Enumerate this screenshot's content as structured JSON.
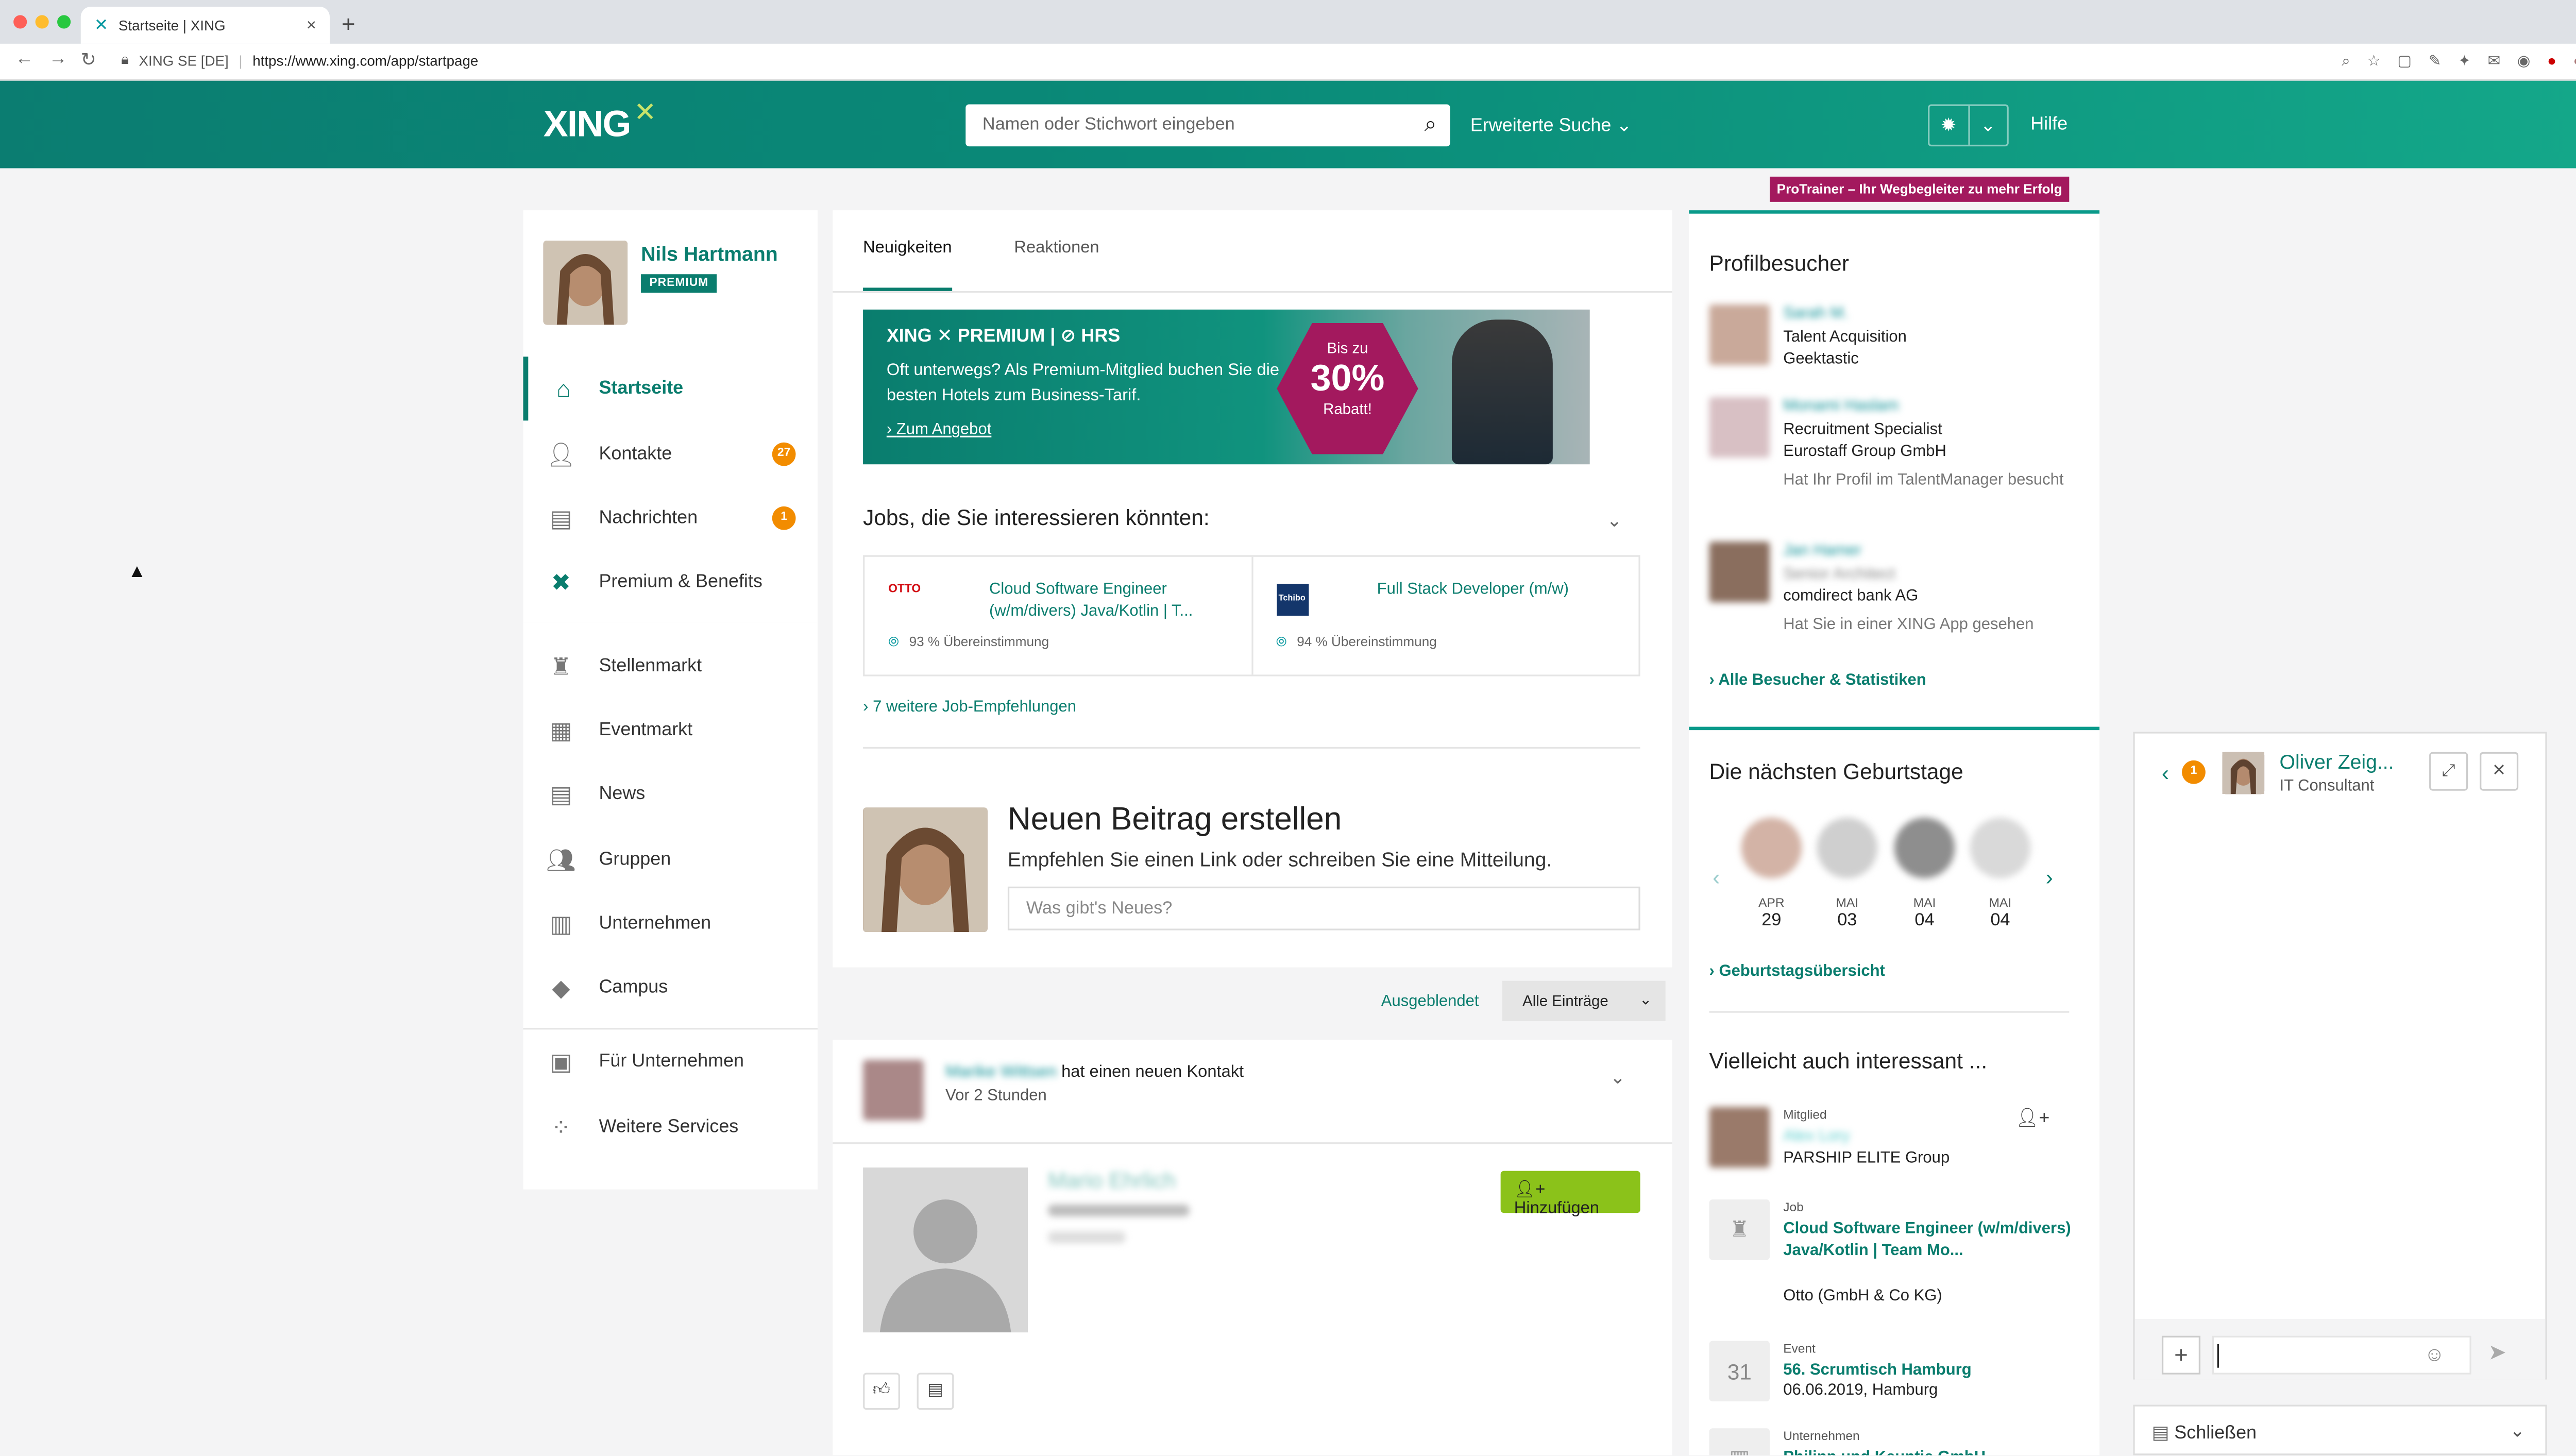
{
  "browser": {
    "tab_title": "Startseite | XING",
    "tab_close": "×",
    "new_tab": "+",
    "site_identity": "XING SE [DE]",
    "url": "https://www.xing.com/app/startpage"
  },
  "header": {
    "logo": "XING",
    "search_placeholder": "Namen oder Stichwort eingeben",
    "advanced_search": "Erweiterte Suche",
    "help": "Hilfe",
    "promo_tag": "ProTrainer – Ihr Wegbegleiter zu mehr Erfolg"
  },
  "profile": {
    "name": "Nils Hartmann",
    "badge": "PREMIUM"
  },
  "sidebar": {
    "items": [
      {
        "label": "Startseite",
        "icon": "home-icon"
      },
      {
        "label": "Kontakte",
        "icon": "person-icon",
        "badge": "27"
      },
      {
        "label": "Nachrichten",
        "icon": "chat-icon",
        "badge": "1"
      },
      {
        "label": "Premium & Benefits",
        "icon": "xing-icon"
      },
      {
        "label": "Stellenmarkt",
        "icon": "chair-icon"
      },
      {
        "label": "Eventmarkt",
        "icon": "calendar-icon"
      },
      {
        "label": "News",
        "icon": "news-icon"
      },
      {
        "label": "Gruppen",
        "icon": "group-icon"
      },
      {
        "label": "Unternehmen",
        "icon": "building-icon"
      },
      {
        "label": "Campus",
        "icon": "graduation-icon"
      },
      {
        "label": "Für Unternehmen",
        "icon": "presentation-icon"
      },
      {
        "label": "Weitere Services",
        "icon": "dots-icon"
      }
    ]
  },
  "main": {
    "tabs": [
      "Neuigkeiten",
      "Reaktionen"
    ],
    "banner": {
      "brand": "XING ✕ PREMIUM | ⊘ HRS",
      "text": "Oft unterwegs? Als Premium-Mitglied buchen Sie die besten Hotels zum Business-Tarif.",
      "link": "Zum Angebot",
      "discount_top": "Bis zu",
      "discount_value": "30%",
      "discount_bottom": "Rabatt!"
    },
    "jobs_heading": "Jobs, die Sie interessieren könnten:",
    "jobs": [
      {
        "company_logo": "OTTO",
        "title": "Cloud Software Engineer (w/m/divers) Java/Kotlin | T...",
        "match": "93 % Übereinstimmung"
      },
      {
        "company_logo": "Tchibo",
        "title": "Full Stack Developer (m/w)",
        "match": "94 % Übereinstimmung"
      }
    ],
    "more_jobs": "7 weitere Job-Empfehlungen",
    "new_post": {
      "title": "Neuen Beitrag erstellen",
      "subtitle": "Empfehlen Sie einen Link oder schreiben Sie eine Mitteilung.",
      "placeholder": "Was gibt's Neues?"
    },
    "filter": {
      "hidden": "Ausgeblendet",
      "select": "Alle Einträge"
    },
    "feed_item": {
      "actor": "Marike Wittsen",
      "action": "hat einen neuen Kontakt",
      "time": "Vor 2 Stunden",
      "contact_name": "Mario Ehrlich",
      "add_button": "Hinzufügen"
    }
  },
  "right": {
    "visitors_heading": "Profilbesucher",
    "visitors": [
      {
        "name": "Sarah M.",
        "role": "Talent Acquisition",
        "company": "Geektastic",
        "note": ""
      },
      {
        "name": "Monami Haslam",
        "role": "Recruitment Specialist",
        "company": "Eurostaff Group GmbH",
        "note": "Hat Ihr Profil im TalentManager besucht"
      },
      {
        "name": "Jan Hamer",
        "role": "Senior Architect",
        "company": "comdirect bank AG",
        "note": "Hat Sie in einer XING App gesehen"
      }
    ],
    "visitors_link": "Alle Besucher & Statistiken",
    "birthdays_heading": "Die nächsten Geburtstage",
    "birthdays": [
      {
        "month": "APR",
        "day": "29"
      },
      {
        "month": "MAI",
        "day": "03"
      },
      {
        "month": "MAI",
        "day": "04"
      },
      {
        "month": "MAI",
        "day": "04"
      }
    ],
    "birthdays_link": "Geburtstagsübersicht",
    "maybe_heading": "Vielleicht auch interessant ...",
    "maybe": [
      {
        "type": "Mitglied",
        "link": "Alex Lory",
        "sub": "PARSHIP ELITE Group"
      },
      {
        "type": "Job",
        "link": "Cloud Software Engineer (w/m/divers) Java/Kotlin | Team Mo...",
        "sub": "Otto (GmbH & Co KG)"
      },
      {
        "type": "Event",
        "link": "56. Scrumtisch Hamburg",
        "sub": "06.06.2019, Hamburg",
        "icon_text": "31"
      },
      {
        "type": "Unternehmen",
        "link": "Philipp und Keuntje GmbH",
        "sub": ""
      }
    ]
  },
  "chat": {
    "count": "1",
    "name": "Oliver Zeig...",
    "role": "IT Consultant",
    "close_bar": "Schließen"
  }
}
